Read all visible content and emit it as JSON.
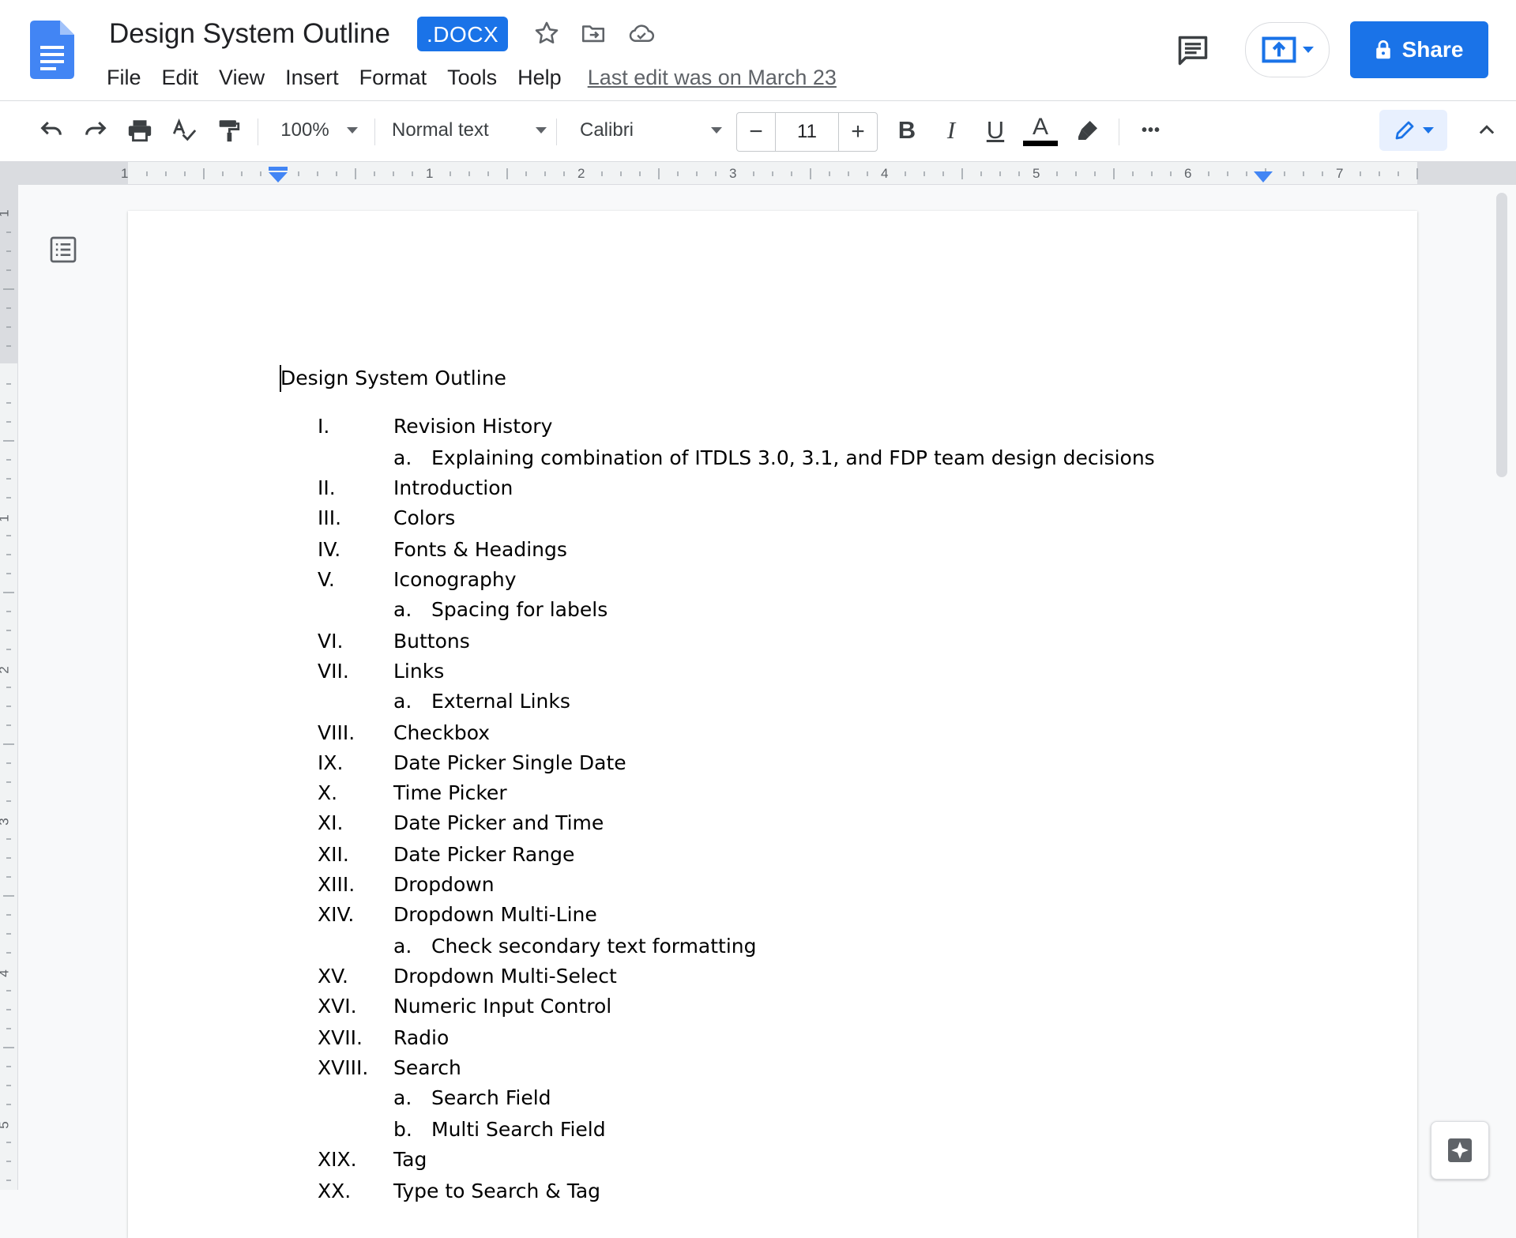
{
  "app": {
    "title": "Design System Outline",
    "badge": ".DOCX",
    "last_edit": "Last edit was on March 23",
    "share_label": "Share",
    "colors": {
      "accent": "#1a73e8",
      "page": "#ffffff",
      "background": "#f8f9fa"
    }
  },
  "header_icons": [
    "star-icon",
    "move-to-folder-icon",
    "cloud-status-icon",
    "comments-icon",
    "present-icon",
    "lock-icon"
  ],
  "menu": [
    "File",
    "Edit",
    "View",
    "Insert",
    "Format",
    "Tools",
    "Help"
  ],
  "toolbar": {
    "zoom": "100%",
    "style": "Normal text",
    "font": "Calibri",
    "font_size": "11",
    "minus": "−",
    "plus": "+",
    "bold": "B",
    "italic": "I",
    "underline": "U",
    "text_color": "A",
    "text_color_value": "#000000",
    "more": "•••"
  },
  "ruler": {
    "h_numbers": [
      "1",
      "1",
      "2",
      "3",
      "4",
      "5",
      "6",
      "7"
    ],
    "v_numbers": [
      "1",
      "1",
      "2",
      "3",
      "4",
      "5"
    ]
  },
  "document": {
    "heading": "Design System Outline",
    "outline": [
      {
        "marker": "I.",
        "text": "Revision History",
        "level": 1
      },
      {
        "marker": "a.",
        "text": "Explaining combination of ITDLS 3.0, 3.1, and FDP team design decisions",
        "level": 2
      },
      {
        "marker": "II.",
        "text": "Introduction",
        "level": 1
      },
      {
        "marker": "III.",
        "text": "Colors",
        "level": 1
      },
      {
        "marker": "IV.",
        "text": "Fonts & Headings",
        "level": 1
      },
      {
        "marker": "V.",
        "text": "Iconography",
        "level": 1
      },
      {
        "marker": "a.",
        "text": "Spacing for labels",
        "level": 2
      },
      {
        "marker": "VI.",
        "text": "Buttons",
        "level": 1
      },
      {
        "marker": "VII.",
        "text": "Links",
        "level": 1
      },
      {
        "marker": "a.",
        "text": "External Links",
        "level": 2
      },
      {
        "marker": "VIII.",
        "text": "Checkbox",
        "level": 1
      },
      {
        "marker": "IX.",
        "text": "Date Picker Single Date",
        "level": 1
      },
      {
        "marker": "X.",
        "text": "Time Picker",
        "level": 1
      },
      {
        "marker": "XI.",
        "text": "Date Picker and Time",
        "level": 1
      },
      {
        "marker": "XII.",
        "text": "Date Picker Range",
        "level": 1
      },
      {
        "marker": "XIII.",
        "text": "Dropdown",
        "level": 1
      },
      {
        "marker": "XIV.",
        "text": "Dropdown Multi-Line",
        "level": 1
      },
      {
        "marker": "a.",
        "text": "Check secondary text formatting",
        "level": 2
      },
      {
        "marker": "XV.",
        "text": "Dropdown Multi-Select",
        "level": 1
      },
      {
        "marker": "XVI.",
        "text": "Numeric Input Control",
        "level": 1
      },
      {
        "marker": "XVII.",
        "text": "Radio",
        "level": 1
      },
      {
        "marker": "XVIII.",
        "text": "Search",
        "level": 1
      },
      {
        "marker": "a.",
        "text": "Search Field",
        "level": 2
      },
      {
        "marker": "b.",
        "text": "Multi Search Field",
        "level": 2
      },
      {
        "marker": "XIX.",
        "text": "Tag",
        "level": 1
      },
      {
        "marker": "XX.",
        "text": "Type to Search & Tag",
        "level": 1
      }
    ]
  }
}
